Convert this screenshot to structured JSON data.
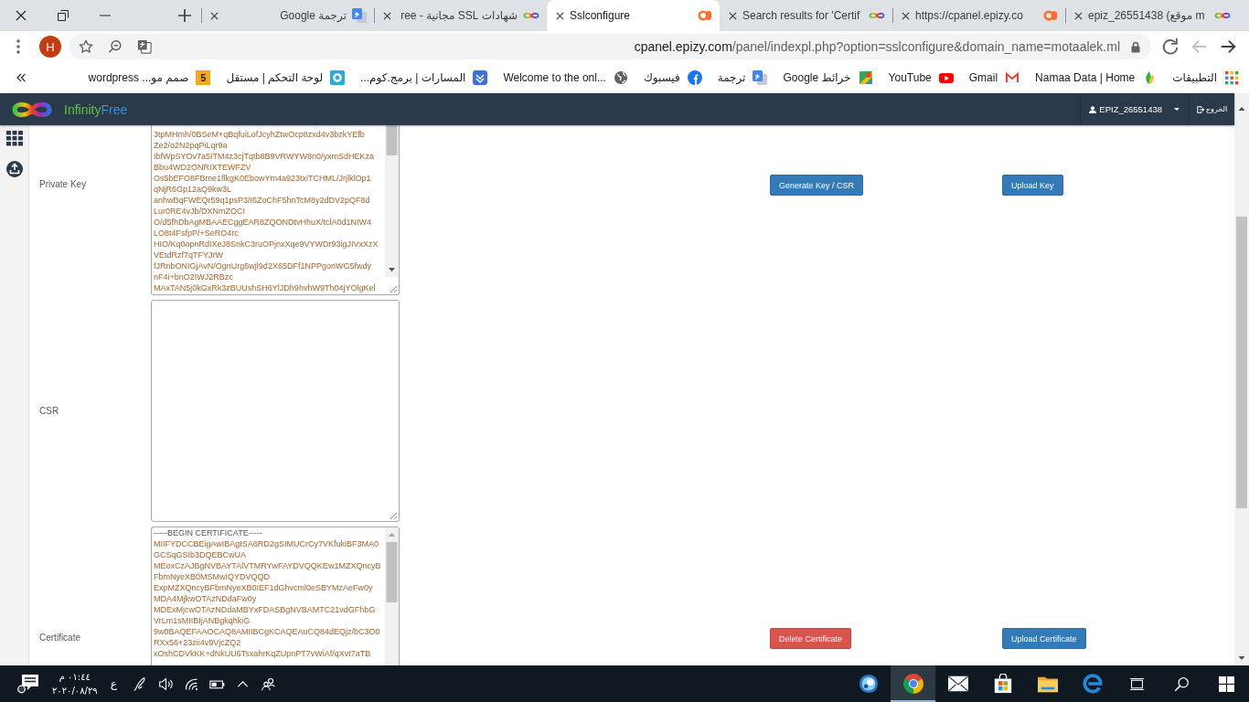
{
  "tabs": [
    {
      "title": "ترجمة Google",
      "kind": "translate",
      "selected": false
    },
    {
      "title": "شهادات SSL مجانية - ree",
      "kind": "infinity",
      "selected": false
    },
    {
      "title": "Sslconfigure",
      "kind": "cpanel",
      "selected": true
    },
    {
      "title": "Search results for 'Certif",
      "kind": "infinity",
      "selected": false
    },
    {
      "title": "https://cpanel.epizy.co",
      "kind": "cpanel",
      "selected": false
    },
    {
      "title": "epiz_26551438 (موقع m",
      "kind": "infinity",
      "selected": false
    }
  ],
  "toolbar": {
    "back": {
      "disabled": false
    },
    "forward": {
      "disabled": true
    },
    "url": {
      "host": "cpanel.epizy.com",
      "path": "/panel/indexpl.php?option=sslconfigure&domain_name=motaalek.ml"
    },
    "profile_initial": "H"
  },
  "bookmarks": [
    {
      "title": "صمم مو... wordpress",
      "kind": "badge",
      "icon_text": "5"
    },
    {
      "title": "لوحة التحكم | مستقل",
      "kind": "ring"
    },
    {
      "title": "المسارات | برمج.كوم...",
      "kind": "square"
    },
    {
      "title": "Welcome to the onl...",
      "kind": "globe"
    },
    {
      "title": "فيسبوك",
      "kind": "social"
    },
    {
      "title": "ترجمة",
      "kind": "translate"
    },
    {
      "title": "خرائط Google",
      "kind": "map"
    },
    {
      "title": "YouTube",
      "kind": "video"
    },
    {
      "title": "Gmail",
      "kind": "mail"
    },
    {
      "title": "Namaa Data | Home",
      "kind": "leaf"
    },
    {
      "title": "التطبيقات",
      "kind": "apps"
    }
  ],
  "page": {
    "brand": {
      "first": "Infinity",
      "second": "Free"
    },
    "account": "EPIZ_26551438",
    "logout": "الخروج",
    "rows": [
      {
        "label": "Private Key",
        "lines": [
          "3tpMHmh/0BSeM+qBqfuiLofJcyhZtwOcp8zxd4v3bzkYEfb",
          "Ze2/o2N2pqPiLqr9a",
          "IbfWpSYOv7a5ITM4z3cjTqtb8B9VRWYW8n0/yxmSdHEKza",
          "Bbu4WD2ONRIXTEWFZV",
          "Os5bEFO8FBme1flkgK0EbowYm4a923txiTCHML/JrjlklOp1",
          "qNjR6Gp12aQ9kw3L",
          "anhwBqFWEQr59q1psP3/I6ZoChF5hnTcM8y2dDV2pQF8d",
          "Lur0RE4vJb/DXNmZOCI",
          "O/d5fhDbAgMBAAECggEAR8ZQONDtvHhuX/tclA0d1NIW4",
          "LO8t4FsfpP/+SeRO4rc",
          "HIO/Kq0opnRdIXeJ8SnkC3ruOPjnxXqe9VYWDr93igJIVxXzX",
          "VEtdRzf7qTFYJrW",
          "fJRnbONIGjAvN/OgnUrg5wjl9d2X65DFf1NPPgonWG5fwdy",
          "nF4i+bnO2IWJ2RBzc",
          "MAxTAN5j0kGxRk3zBUUshSH6YlJDh9hvhW9Th04jYOlgKel"
        ],
        "buttons": [
          {
            "label": "Generate Key / CSR",
            "kind": "primary"
          },
          {
            "label": "Upload Key",
            "kind": "primary"
          }
        ]
      },
      {
        "label": "CSR"
      },
      {
        "label": "Certificate",
        "begin_marker": "-----BEGIN CERTIFICATE-----",
        "lines": [
          "MIIFYDCCBEigAwIBAgISA6RD2gSIMUCrCy7VKfukiBF3MA0",
          "GCSqGSIb3DQEBCwUA",
          "MEoxCzAJBgNVBAYTAlVTMRYwFAYDVQQKEw1MZXQncyB",
          "FbmNyeXB0MSMwIQYDVQQD",
          "ExpMZXQncyBFbmNyeXB0IEF1dGhvcml0eSBYMzAeFw0y",
          "MDA4MjkwOTAzNDdaFw0y",
          "MDExMjcwOTAzNDdaMBYxFDASBgNVBAMTC21vdGFhbG",
          "VrLm1sMIIBIjANBgkqhkiG",
          "9w0BAQEFAAOCAQ8AMIIBCgKCAQEAuCQ84dEQjz/bC3O0",
          "RXx56+23zii4v9VjcZQ2",
          "xOshCDVkKK+dNkUU6TsxahrKqZUpnPT7vWiAf/qXvt7aTB"
        ],
        "buttons": [
          {
            "label": "Delete Certificate",
            "kind": "danger"
          },
          {
            "label": "Upload Certificate",
            "kind": "primary"
          }
        ]
      }
    ]
  },
  "taskbar": {
    "time": "٠١:٤٤ م",
    "date": "٢٠٢٠/٠٨/٢٩",
    "language": "ع",
    "apps": [
      {
        "kind": "circle",
        "selected": false
      },
      {
        "kind": "browser",
        "selected": true
      },
      {
        "kind": "mail",
        "selected": false
      },
      {
        "kind": "store",
        "selected": false
      },
      {
        "kind": "folder",
        "selected": false
      },
      {
        "kind": "edge",
        "selected": false
      }
    ]
  }
}
